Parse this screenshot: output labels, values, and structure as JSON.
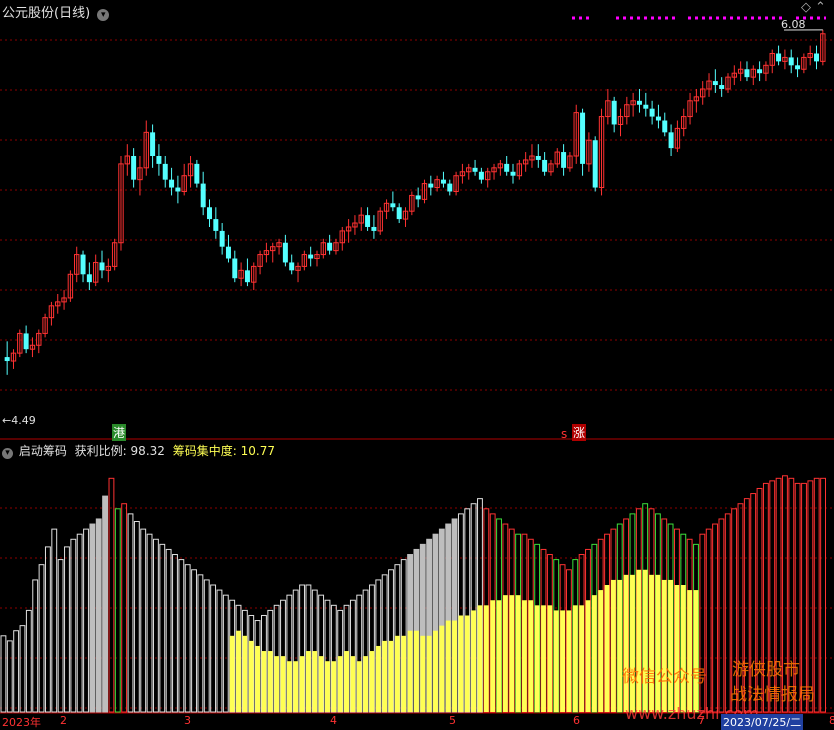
{
  "top_title": "公元股份(日线)",
  "top_title_dropdown_icon": "chevron-down-icon",
  "top_right_icon": "diamond-icon",
  "sub_title": "启动筹码",
  "sub_dropdown_icon": "chevron-down-icon",
  "profit_label": "获利比例:",
  "profit_value": "98.32",
  "conc_label": "筹码集中度:",
  "conc_value": "10.77",
  "price_high_label": "6.08",
  "price_low_label": "4.49",
  "marker_gang": "港",
  "marker_zhang": "涨",
  "marker_s": "s",
  "x_labels": [
    "2023年",
    "2",
    "3",
    "4",
    "5",
    "6",
    "7",
    "2023/07/25/二",
    "8"
  ],
  "watermark": [
    "微信公众号",
    "游侠股市",
    "战法情报局",
    "www.zhuzhi.com"
  ],
  "colors": {
    "up": "#ff3232",
    "down": "#54ffff",
    "grid": "#8b0000",
    "yellow": "#ffff54",
    "green": "#3ce03c",
    "gray": "#bebebe",
    "white": "#e0e0e0",
    "red": "#ff3232",
    "magenta": "#ff00ff"
  },
  "chart_data": [
    {
      "type": "candlestick",
      "title": "公元股份(日线)",
      "y_range": [
        4.2,
        6.3
      ],
      "annotations": {
        "high": 6.08,
        "low": 4.49
      },
      "ohlc": [
        [
          4.58,
          4.66,
          4.49,
          4.56
        ],
        [
          4.56,
          4.62,
          4.52,
          4.6
        ],
        [
          4.6,
          4.72,
          4.58,
          4.7
        ],
        [
          4.7,
          4.74,
          4.6,
          4.62
        ],
        [
          4.62,
          4.68,
          4.58,
          4.64
        ],
        [
          4.64,
          4.72,
          4.6,
          4.7
        ],
        [
          4.7,
          4.8,
          4.68,
          4.78
        ],
        [
          4.78,
          4.86,
          4.74,
          4.84
        ],
        [
          4.84,
          4.9,
          4.8,
          4.86
        ],
        [
          4.86,
          4.92,
          4.82,
          4.88
        ],
        [
          4.88,
          5.02,
          4.86,
          5.0
        ],
        [
          5.0,
          5.14,
          4.96,
          5.1
        ],
        [
          5.1,
          5.12,
          4.96,
          5.0
        ],
        [
          5.0,
          5.06,
          4.92,
          4.96
        ],
        [
          4.96,
          5.1,
          4.94,
          5.06
        ],
        [
          5.06,
          5.12,
          4.98,
          5.02
        ],
        [
          5.02,
          5.08,
          4.96,
          5.04
        ],
        [
          5.04,
          5.18,
          5.02,
          5.16
        ],
        [
          5.16,
          5.6,
          5.12,
          5.56
        ],
        [
          5.56,
          5.66,
          5.5,
          5.6
        ],
        [
          5.6,
          5.64,
          5.44,
          5.48
        ],
        [
          5.48,
          5.6,
          5.4,
          5.54
        ],
        [
          5.54,
          5.78,
          5.5,
          5.72
        ],
        [
          5.72,
          5.76,
          5.54,
          5.6
        ],
        [
          5.6,
          5.66,
          5.5,
          5.56
        ],
        [
          5.56,
          5.6,
          5.44,
          5.48
        ],
        [
          5.48,
          5.54,
          5.4,
          5.44
        ],
        [
          5.44,
          5.5,
          5.36,
          5.42
        ],
        [
          5.42,
          5.56,
          5.4,
          5.5
        ],
        [
          5.5,
          5.6,
          5.44,
          5.56
        ],
        [
          5.56,
          5.58,
          5.44,
          5.46
        ],
        [
          5.46,
          5.52,
          5.3,
          5.34
        ],
        [
          5.34,
          5.38,
          5.24,
          5.28
        ],
        [
          5.28,
          5.34,
          5.18,
          5.22
        ],
        [
          5.22,
          5.26,
          5.1,
          5.14
        ],
        [
          5.14,
          5.2,
          5.06,
          5.08
        ],
        [
          5.08,
          5.12,
          4.96,
          4.98
        ],
        [
          4.98,
          5.06,
          4.94,
          5.02
        ],
        [
          5.02,
          5.08,
          4.94,
          4.96
        ],
        [
          4.96,
          5.06,
          4.92,
          5.04
        ],
        [
          5.04,
          5.12,
          5.0,
          5.1
        ],
        [
          5.1,
          5.16,
          5.06,
          5.12
        ],
        [
          5.12,
          5.16,
          5.06,
          5.14
        ],
        [
          5.14,
          5.18,
          5.1,
          5.16
        ],
        [
          5.16,
          5.2,
          5.04,
          5.06
        ],
        [
          5.06,
          5.1,
          5.0,
          5.02
        ],
        [
          5.02,
          5.06,
          4.96,
          5.04
        ],
        [
          5.04,
          5.12,
          5.02,
          5.1
        ],
        [
          5.1,
          5.14,
          5.04,
          5.08
        ],
        [
          5.08,
          5.12,
          5.04,
          5.1
        ],
        [
          5.1,
          5.18,
          5.08,
          5.16
        ],
        [
          5.16,
          5.2,
          5.1,
          5.12
        ],
        [
          5.12,
          5.18,
          5.1,
          5.16
        ],
        [
          5.16,
          5.24,
          5.12,
          5.22
        ],
        [
          5.22,
          5.28,
          5.16,
          5.24
        ],
        [
          5.24,
          5.3,
          5.2,
          5.26
        ],
        [
          5.26,
          5.34,
          5.22,
          5.3
        ],
        [
          5.3,
          5.34,
          5.22,
          5.24
        ],
        [
          5.24,
          5.3,
          5.18,
          5.22
        ],
        [
          5.22,
          5.34,
          5.2,
          5.32
        ],
        [
          5.32,
          5.38,
          5.28,
          5.36
        ],
        [
          5.36,
          5.42,
          5.32,
          5.34
        ],
        [
          5.34,
          5.36,
          5.26,
          5.28
        ],
        [
          5.28,
          5.34,
          5.24,
          5.32
        ],
        [
          5.32,
          5.42,
          5.3,
          5.4
        ],
        [
          5.4,
          5.44,
          5.34,
          5.38
        ],
        [
          5.38,
          5.48,
          5.36,
          5.46
        ],
        [
          5.46,
          5.5,
          5.4,
          5.44
        ],
        [
          5.44,
          5.5,
          5.42,
          5.48
        ],
        [
          5.48,
          5.52,
          5.44,
          5.46
        ],
        [
          5.46,
          5.48,
          5.4,
          5.42
        ],
        [
          5.42,
          5.52,
          5.4,
          5.5
        ],
        [
          5.5,
          5.56,
          5.46,
          5.52
        ],
        [
          5.52,
          5.56,
          5.48,
          5.54
        ],
        [
          5.54,
          5.58,
          5.5,
          5.52
        ],
        [
          5.52,
          5.54,
          5.46,
          5.48
        ],
        [
          5.48,
          5.54,
          5.44,
          5.52
        ],
        [
          5.52,
          5.56,
          5.48,
          5.54
        ],
        [
          5.54,
          5.58,
          5.5,
          5.56
        ],
        [
          5.56,
          5.6,
          5.5,
          5.52
        ],
        [
          5.52,
          5.56,
          5.46,
          5.5
        ],
        [
          5.5,
          5.58,
          5.48,
          5.56
        ],
        [
          5.56,
          5.62,
          5.52,
          5.58
        ],
        [
          5.58,
          5.66,
          5.54,
          5.6
        ],
        [
          5.6,
          5.66,
          5.54,
          5.58
        ],
        [
          5.58,
          5.62,
          5.5,
          5.52
        ],
        [
          5.52,
          5.58,
          5.5,
          5.56
        ],
        [
          5.56,
          5.64,
          5.54,
          5.62
        ],
        [
          5.62,
          5.66,
          5.5,
          5.54
        ],
        [
          5.54,
          5.62,
          5.52,
          5.6
        ],
        [
          5.6,
          5.86,
          5.56,
          5.82
        ],
        [
          5.82,
          5.84,
          5.5,
          5.56
        ],
        [
          5.56,
          5.72,
          5.52,
          5.68
        ],
        [
          5.68,
          5.7,
          5.42,
          5.44
        ],
        [
          5.44,
          5.84,
          5.4,
          5.8
        ],
        [
          5.8,
          5.94,
          5.76,
          5.88
        ],
        [
          5.88,
          5.9,
          5.72,
          5.76
        ],
        [
          5.76,
          5.84,
          5.7,
          5.8
        ],
        [
          5.8,
          5.9,
          5.76,
          5.86
        ],
        [
          5.86,
          5.92,
          5.8,
          5.88
        ],
        [
          5.88,
          5.94,
          5.82,
          5.86
        ],
        [
          5.86,
          5.92,
          5.8,
          5.84
        ],
        [
          5.84,
          5.88,
          5.76,
          5.8
        ],
        [
          5.8,
          5.86,
          5.74,
          5.78
        ],
        [
          5.78,
          5.82,
          5.7,
          5.72
        ],
        [
          5.72,
          5.76,
          5.6,
          5.64
        ],
        [
          5.64,
          5.78,
          5.62,
          5.74
        ],
        [
          5.74,
          5.84,
          5.7,
          5.8
        ],
        [
          5.8,
          5.92,
          5.76,
          5.88
        ],
        [
          5.88,
          5.94,
          5.82,
          5.9
        ],
        [
          5.9,
          5.98,
          5.86,
          5.94
        ],
        [
          5.94,
          6.02,
          5.9,
          5.98
        ],
        [
          5.98,
          6.04,
          5.92,
          5.96
        ],
        [
          5.96,
          6.0,
          5.9,
          5.94
        ],
        [
          5.94,
          6.02,
          5.92,
          6.0
        ],
        [
          6.0,
          6.06,
          5.96,
          6.02
        ],
        [
          6.02,
          6.08,
          5.98,
          6.04
        ],
        [
          6.04,
          6.08,
          5.98,
          6.0
        ],
        [
          6.0,
          6.06,
          5.96,
          6.04
        ],
        [
          6.04,
          6.08,
          5.98,
          6.02
        ],
        [
          6.02,
          6.08,
          5.98,
          6.06
        ],
        [
          6.06,
          6.14,
          6.02,
          6.12
        ],
        [
          6.12,
          6.16,
          6.06,
          6.08
        ],
        [
          6.08,
          6.14,
          6.04,
          6.1
        ],
        [
          6.1,
          6.14,
          6.02,
          6.06
        ],
        [
          6.06,
          6.1,
          6.0,
          6.04
        ],
        [
          6.04,
          6.12,
          6.02,
          6.1
        ],
        [
          6.1,
          6.16,
          6.06,
          6.12
        ],
        [
          6.12,
          6.16,
          6.04,
          6.08
        ],
        [
          6.08,
          6.24,
          6.06,
          6.22
        ]
      ]
    },
    {
      "type": "bar",
      "title": "启动筹码",
      "y_range": [
        0,
        100
      ],
      "profit_ratio": 98.32,
      "concentration": 10.77,
      "outline": [
        30,
        28,
        32,
        34,
        40,
        52,
        58,
        65,
        72,
        60,
        65,
        68,
        70,
        72,
        74,
        76,
        85,
        92,
        80,
        82,
        78,
        75,
        72,
        70,
        68,
        66,
        64,
        62,
        60,
        58,
        56,
        54,
        52,
        50,
        48,
        46,
        44,
        42,
        40,
        38,
        36,
        38,
        40,
        42,
        44,
        46,
        48,
        50,
        50,
        48,
        46,
        44,
        42,
        40,
        42,
        44,
        46,
        48,
        50,
        52,
        54,
        56,
        58,
        60,
        62,
        64,
        66,
        68,
        70,
        72,
        74,
        76,
        78,
        80,
        82,
        84,
        80,
        78,
        76,
        74,
        72,
        70,
        70,
        68,
        66,
        64,
        62,
        60,
        58,
        56,
        60,
        62,
        64,
        66,
        68,
        70,
        72,
        74,
        76,
        78,
        80,
        82,
        80,
        78,
        76,
        74,
        72,
        70,
        68,
        66,
        70,
        72,
        74,
        76,
        78,
        80,
        82,
        84,
        86,
        88,
        90,
        91,
        92,
        93,
        92,
        90,
        90,
        91,
        92,
        92
      ],
      "fill": [
        0,
        0,
        0,
        0,
        0,
        0,
        0,
        0,
        0,
        0,
        0,
        0,
        0,
        0,
        0,
        0,
        0,
        0,
        0,
        0,
        0,
        0,
        0,
        0,
        0,
        0,
        0,
        0,
        0,
        0,
        0,
        0,
        0,
        0,
        0,
        0,
        30,
        32,
        30,
        28,
        26,
        24,
        24,
        22,
        22,
        20,
        20,
        22,
        24,
        24,
        22,
        20,
        20,
        22,
        24,
        22,
        20,
        22,
        24,
        26,
        28,
        28,
        30,
        30,
        32,
        32,
        30,
        30,
        32,
        34,
        36,
        36,
        38,
        38,
        40,
        42,
        42,
        44,
        44,
        46,
        46,
        46,
        44,
        44,
        42,
        42,
        42,
        40,
        40,
        40,
        42,
        42,
        44,
        46,
        48,
        50,
        52,
        52,
        54,
        54,
        56,
        56,
        54,
        54,
        52,
        52,
        50,
        50,
        48,
        48,
        0,
        0,
        0,
        0,
        0,
        0,
        0,
        0,
        0,
        0,
        0,
        0,
        0,
        0,
        0,
        0,
        0,
        0,
        0,
        0
      ],
      "state": "per-bar color: gray, white, green, red"
    }
  ]
}
